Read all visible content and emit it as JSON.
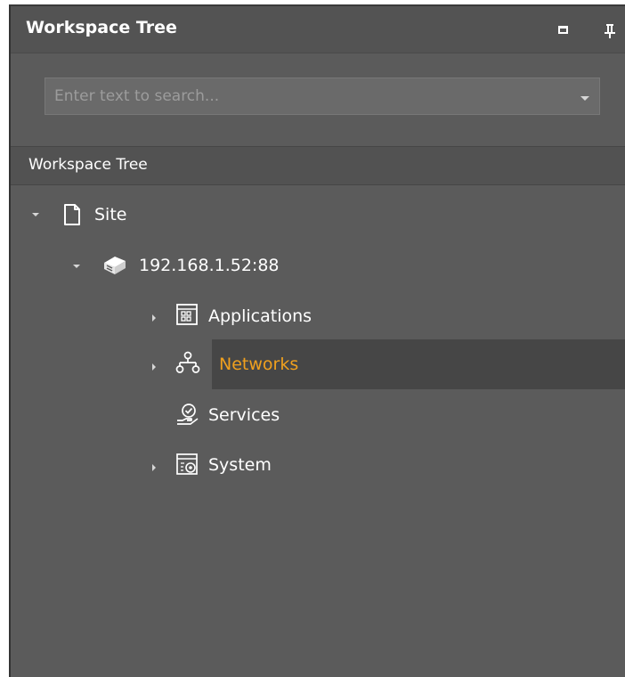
{
  "panel": {
    "title": "Workspace Tree"
  },
  "search": {
    "placeholder": "Enter text to search...",
    "value": ""
  },
  "section": {
    "title": "Workspace Tree"
  },
  "tree": {
    "site": {
      "label": "Site",
      "icon": "document-icon",
      "state": "expanded"
    },
    "server": {
      "label": "192.168.1.52:88",
      "icon": "server-icon",
      "state": "expanded"
    },
    "applications": {
      "label": "Applications",
      "icon": "applications-icon",
      "state": "collapsed"
    },
    "networks": {
      "label": "Networks",
      "icon": "network-icon",
      "state": "collapsed",
      "selected": true
    },
    "services": {
      "label": "Services",
      "icon": "services-icon"
    },
    "system": {
      "label": "System",
      "icon": "system-icon",
      "state": "collapsed"
    }
  },
  "colors": {
    "panel_bg": "#5b5b5b",
    "selected_row_bg": "#464646",
    "highlight_text": "#f0a01e",
    "text": "#ffffff"
  }
}
